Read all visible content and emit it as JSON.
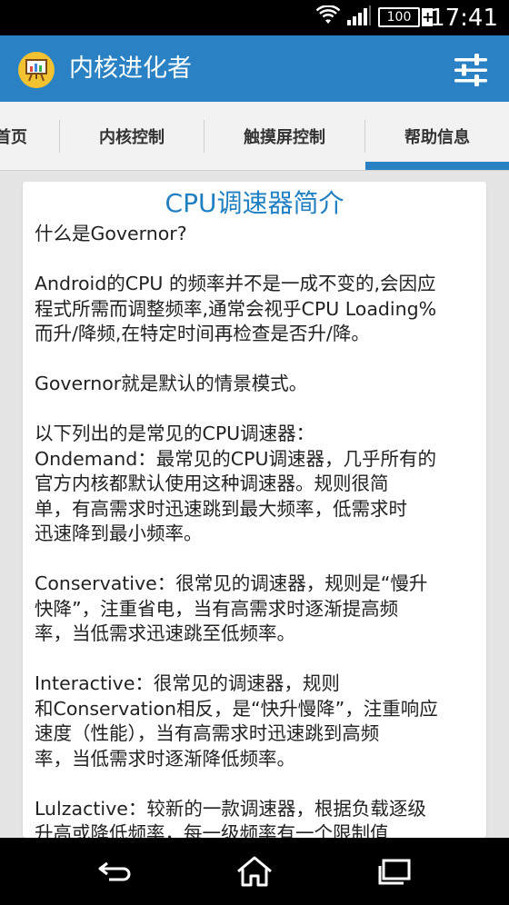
{
  "status_bar": {
    "battery_level": "100",
    "charging_symbol": "+",
    "time": "17:41"
  },
  "app_bar": {
    "title": "内核进化者",
    "app_icon": "presentation-board-icon",
    "settings_icon": "sliders-icon",
    "colors": {
      "background": "#2a82c4",
      "icon_bg": "#f2c230"
    }
  },
  "tabs": [
    {
      "label": "首页",
      "selected": false
    },
    {
      "label": "内核控制",
      "selected": false
    },
    {
      "label": "触摸屏控制",
      "selected": false
    },
    {
      "label": "帮助信息",
      "selected": true
    }
  ],
  "content": {
    "title": "CPU调速器简介",
    "paragraphs": [
      [
        "什么是Governor?"
      ],
      [
        "Android的CPU 的频率并不是一成不变的,会因应",
        "程式所需而调整频率,通常会视乎CPU Loading%",
        "而升/降频,在特定时间再检查是否升/降。"
      ],
      [
        "Governor就是默认的情景模式。"
      ],
      [
        "以下列出的是常见的CPU调速器：",
        "Ondemand：最常见的CPU调速器，几乎所有的",
        "官方内核都默认使用这种调速器。规则很简",
        "单，有高需求时迅速跳到最大频率，低需求时",
        "迅速降到最小频率。"
      ],
      [
        "Conservative：很常见的调速器，规则是“慢升",
        "快降”，注重省电，当有高需求时逐渐提高频",
        "率，当低需求迅速跳至低频率。"
      ],
      [
        "Interactive：很常见的调速器，规则",
        "和Conservation相反，是“快升慢降”，注重响应",
        "速度（性能），当有高需求时迅速跳到高频",
        "率，当低需求时逐渐降低频率。"
      ],
      [
        "Lulzactive：较新的一款调速器，根据负载逐级",
        "升高或降低频率，每一级频率有一个限制值"
      ]
    ]
  },
  "nav_bar": {
    "back_icon": "back-arrow-icon",
    "home_icon": "home-icon",
    "recents_icon": "recent-apps-icon"
  }
}
